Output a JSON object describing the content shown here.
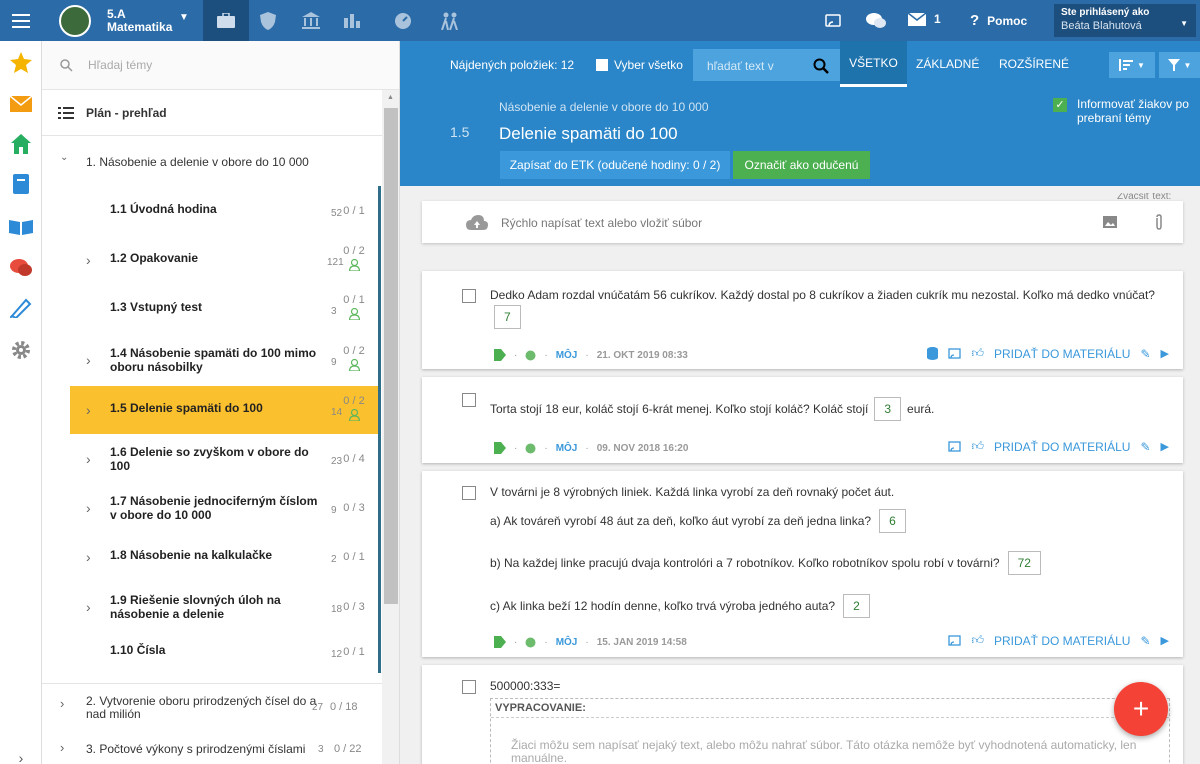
{
  "topbar": {
    "class_code": "5.A",
    "subject": "Matematika",
    "mail_count": "1",
    "help_label": "Pomoc",
    "logged_as_label": "Ste prihlásený ako",
    "user_name": "Beáta Blahutová"
  },
  "sidebar": {
    "search_placeholder": "Hľadaj témy",
    "plan_label": "Plán - prehľad",
    "chapter1": "1. Násobenie a delenie v obore do 10 000",
    "topics": [
      {
        "title": "1.1 Úvodná hodina",
        "count": "52",
        "progress": "0 / 1"
      },
      {
        "title": "1.2 Opakovanie",
        "count": "121",
        "progress": "0 / 2"
      },
      {
        "title": "1.3 Vstupný test",
        "count": "3",
        "progress": "0 / 1"
      },
      {
        "title": "1.4 Násobenie spamäti do 100 mimo oboru násobilky",
        "count": "9",
        "progress": "0 / 2"
      },
      {
        "title": "1.5 Delenie spamäti do 100",
        "count": "14",
        "progress": "0 / 2"
      },
      {
        "title": "1.6 Delenie so zvyškom v obore do 100",
        "count": "23",
        "progress": "0 / 4"
      },
      {
        "title": "1.7 Násobenie jednociferným číslom v obore do 10 000",
        "count": "9",
        "progress": "0 / 3"
      },
      {
        "title": "1.8 Násobenie na kalkulačke",
        "count": "2",
        "progress": "0 / 1"
      },
      {
        "title": "1.9 Riešenie slovných úloh na násobenie a delenie",
        "count": "18",
        "progress": "0 / 3"
      },
      {
        "title": "1.10 Čísla",
        "count": "12",
        "progress": "0 / 1"
      }
    ],
    "chapter2": "2. Vytvorenie oboru prirodzených čísel do a nad milión",
    "chapter2_count": "27",
    "chapter2_progress": "0 / 18",
    "chapter3": "3. Počtové výkony s prirodzenými číslami",
    "chapter3_count": "3",
    "chapter3_progress": "0 / 22"
  },
  "toolbar": {
    "found_label": "Nájdených položiek: 12",
    "select_all": "Vyber všetko",
    "search_placeholder": "hľadať text v",
    "filter_all": "VŠETKO",
    "filter_basic": "ZÁKLADNÉ",
    "filter_extended": "ROZŠÍRENÉ"
  },
  "header": {
    "breadcrumb": "Násobenie a delenie v obore do 10 000",
    "number": "1.5",
    "title": "Delenie spamäti do 100",
    "etk_button": "Zapísať do ETK (odučené hodiny: 0 / 2)",
    "mark_button": "Označiť ako odučenú",
    "inform_label": "Informovať žiakov po prebraní témy"
  },
  "composer": {
    "placeholder": "Rýchlo napísať text alebo vložiť súbor",
    "corner_hint": "Zväčšiť text:"
  },
  "common": {
    "moj": "MÔJ",
    "add_to_material": "PRIDAŤ DO MATERIÁLU",
    "worksheet_label": "VYPRACOVANIE:",
    "worksheet_placeholder": "Žiaci môžu sem napísať nejaký text, alebo môžu nahrať súbor. Táto otázka nemôže byť vyhodnotená automaticky, len manuálne."
  },
  "questions": [
    {
      "text": "Dedko Adam rozdal vnúčatám 56 cukríkov. Každý dostal po 8 cukríkov a žiaden cukrík mu nezostal. Koľko má dedko vnúčat?",
      "answer": "7",
      "date": "21. OKT 2019 08:33"
    },
    {
      "text": "Torta stojí 18 eur, koláč stojí 6-krát menej. Koľko stojí koláč? Koláč stojí",
      "answer": "3",
      "suffix": "eurá.",
      "date": "09. NOV 2018 16:20"
    },
    {
      "text": "V továrni je 8 výrobných liniek. Každá linka vyrobí za deň rovnaký počet áut.",
      "sub": [
        {
          "text": "a) Ak továreň vyrobí 48 áut za deň, koľko áut vyrobí za deň jedna linka?",
          "answer": "6"
        },
        {
          "text": "b) Na každej linke pracujú dvaja kontrolóri a 7 robotníkov. Koľko robotníkov spolu robí v továrni?",
          "answer": "72"
        },
        {
          "text": "c) Ak linka beží 12 hodín denne, koľko trvá výroba jedného auta?",
          "answer": "2"
        }
      ],
      "date": "15. JAN 2019 14:58"
    },
    {
      "text": "500000:333="
    }
  ]
}
